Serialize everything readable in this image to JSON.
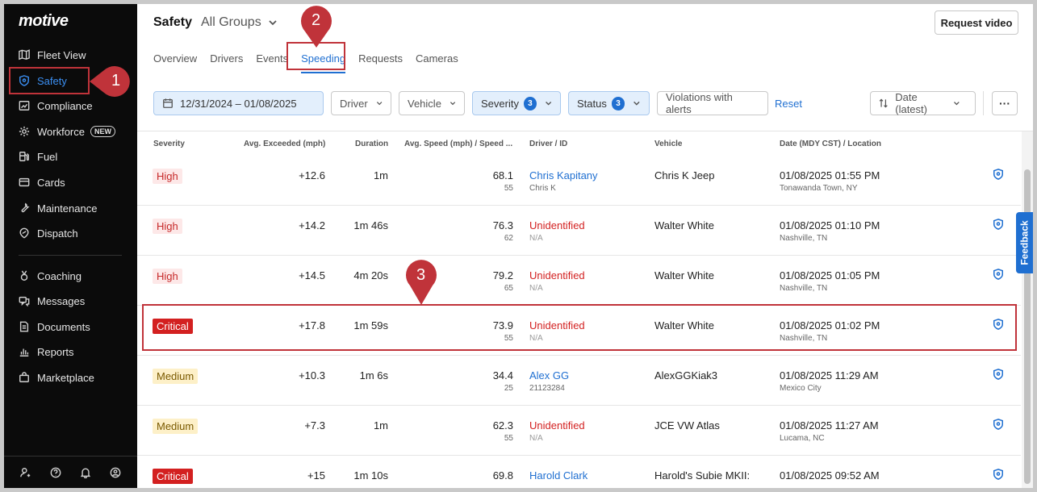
{
  "sidebar": {
    "logo": "motive",
    "items": [
      {
        "label": "Fleet View",
        "icon": "map-icon"
      },
      {
        "label": "Safety",
        "icon": "shield-icon"
      },
      {
        "label": "Compliance",
        "icon": "document-chart-icon"
      },
      {
        "label": "Workforce",
        "icon": "gear-icon",
        "badge": "NEW"
      },
      {
        "label": "Fuel",
        "icon": "fuel-pump-icon"
      },
      {
        "label": "Cards",
        "icon": "card-icon"
      },
      {
        "label": "Maintenance",
        "icon": "wrench-icon"
      },
      {
        "label": "Dispatch",
        "icon": "dispatch-icon"
      },
      {
        "label": "Coaching",
        "icon": "medal-icon"
      },
      {
        "label": "Messages",
        "icon": "chat-icon"
      },
      {
        "label": "Documents",
        "icon": "document-icon"
      },
      {
        "label": "Reports",
        "icon": "chart-icon"
      },
      {
        "label": "Marketplace",
        "icon": "bag-icon"
      }
    ],
    "footer_icons": [
      "user-settings-icon",
      "help-icon",
      "bell-icon",
      "profile-icon"
    ]
  },
  "header": {
    "title": "Safety",
    "group": "All Groups",
    "request_button": "Request video"
  },
  "tabs": [
    "Overview",
    "Drivers",
    "Events",
    "Speeding",
    "Requests",
    "Cameras"
  ],
  "active_tab": "Speeding",
  "filters": {
    "date_range": "12/31/2024 – 01/08/2025",
    "driver": "Driver",
    "vehicle": "Vehicle",
    "severity": "Severity",
    "severity_count": "3",
    "status": "Status",
    "status_count": "3",
    "violations": "Violations with alerts",
    "reset": "Reset",
    "sort": "Date (latest)",
    "more": "···"
  },
  "table": {
    "columns": [
      "Severity",
      "Avg. Exceeded (mph)",
      "Duration",
      "Avg. Speed (mph) / Speed ...",
      "Driver / ID",
      "Vehicle",
      "Date (MDY CST) / Location"
    ],
    "rows": [
      {
        "severity": "High",
        "exceeded": "+12.6",
        "duration": "1m",
        "speed": "68.1",
        "limit": "55",
        "driver": "Chris Kapitany",
        "driver_id": "Chris K",
        "vehicle": "Chris K Jeep",
        "date": "01/08/2025 01:55 PM",
        "location": "Tonawanda Town, NY"
      },
      {
        "severity": "High",
        "exceeded": "+14.2",
        "duration": "1m 46s",
        "speed": "76.3",
        "limit": "62",
        "driver": "Unidentified",
        "driver_id": "N/A",
        "vehicle": "Walter White",
        "date": "01/08/2025 01:10 PM",
        "location": "Nashville, TN"
      },
      {
        "severity": "High",
        "exceeded": "+14.5",
        "duration": "4m 20s",
        "speed": "79.2",
        "limit": "65",
        "driver": "Unidentified",
        "driver_id": "N/A",
        "vehicle": "Walter White",
        "date": "01/08/2025 01:05 PM",
        "location": "Nashville, TN"
      },
      {
        "severity": "Critical",
        "exceeded": "+17.8",
        "duration": "1m 59s",
        "speed": "73.9",
        "limit": "55",
        "driver": "Unidentified",
        "driver_id": "N/A",
        "vehicle": "Walter White",
        "date": "01/08/2025 01:02 PM",
        "location": "Nashville, TN"
      },
      {
        "severity": "Medium",
        "exceeded": "+10.3",
        "duration": "1m 6s",
        "speed": "34.4",
        "limit": "25",
        "driver": "Alex GG",
        "driver_id": "21123284",
        "vehicle": "AlexGGKiak3",
        "date": "01/08/2025 11:29 AM",
        "location": "Mexico City"
      },
      {
        "severity": "Medium",
        "exceeded": "+7.3",
        "duration": "1m",
        "speed": "62.3",
        "limit": "55",
        "driver": "Unidentified",
        "driver_id": "N/A",
        "vehicle": "JCE VW Atlas",
        "date": "01/08/2025 11:27 AM",
        "location": "Lucama, NC"
      },
      {
        "severity": "Critical",
        "exceeded": "+15",
        "duration": "1m 10s",
        "speed": "69.8",
        "limit": "",
        "driver": "Harold Clark",
        "driver_id": "",
        "vehicle": "Harold's Subie MKII:",
        "date": "01/08/2025 09:52 AM",
        "location": ""
      }
    ]
  },
  "feedback": "Feedback",
  "annotations": [
    "1",
    "2",
    "3"
  ],
  "colors": {
    "accent": "#1f6fd1",
    "critical": "#d32020",
    "annotation": "#c0333a",
    "sidebar": "#0b0b0b"
  }
}
